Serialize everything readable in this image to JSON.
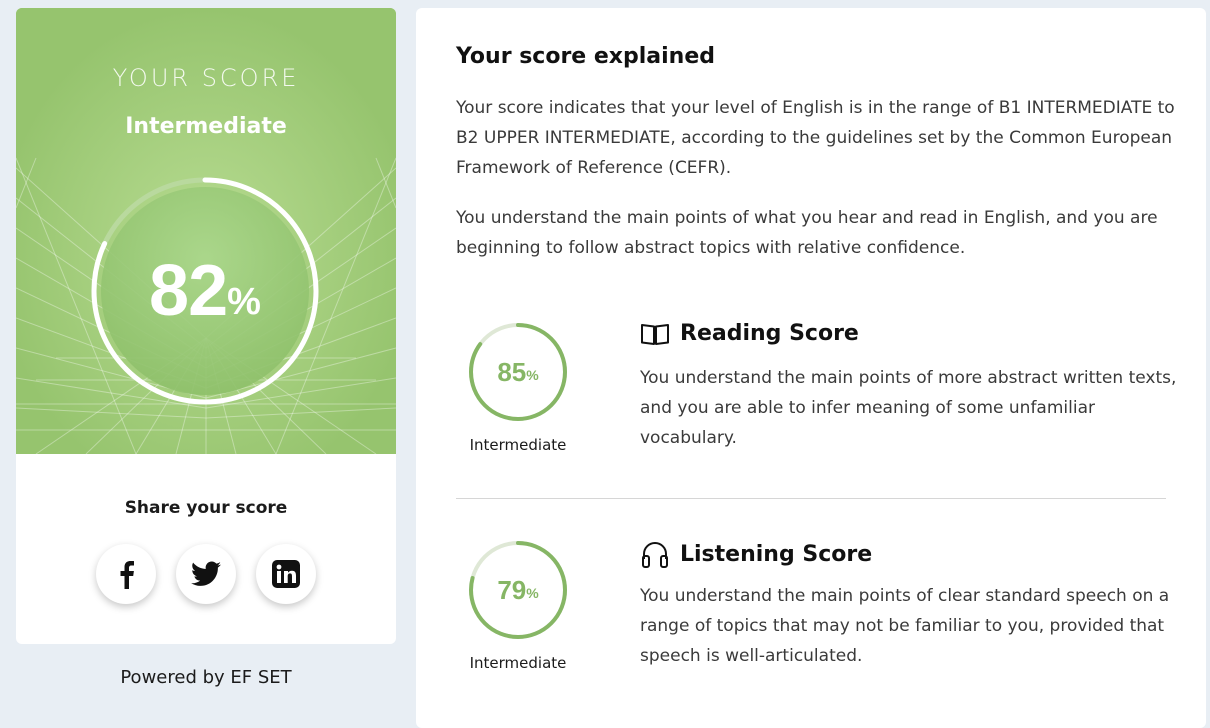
{
  "overall": {
    "label": "YOUR SCORE",
    "level": "Intermediate",
    "value": "82",
    "unit": "%",
    "progress": 0.82,
    "color": "#9cc875"
  },
  "share": {
    "title": "Share your score",
    "buttons": [
      {
        "icon": "facebook-icon"
      },
      {
        "icon": "twitter-icon"
      },
      {
        "icon": "linkedin-icon"
      }
    ]
  },
  "footer": {
    "powered": "Powered by EF SET"
  },
  "explain": {
    "title": "Your score explained",
    "paragraph1": "Your score indicates that your level of English is in the range of B1 INTERMEDIATE to B2 UPPER INTERMEDIATE, according to the guidelines set by the Common European Framework of Reference (CEFR).",
    "paragraph2": "You understand the main points of what you hear and read in English, and you are beginning to follow abstract topics with relative confidence."
  },
  "sections": [
    {
      "icon": "book-icon",
      "title": "Reading Score",
      "value": "85",
      "unit": "%",
      "progress": 0.85,
      "level": "Intermediate",
      "description": "You understand the main points of more abstract written texts, and you are able to infer meaning of some unfamiliar vocabulary."
    },
    {
      "icon": "headphones-icon",
      "title": "Listening Score",
      "value": "79",
      "unit": "%",
      "progress": 0.79,
      "level": "Intermediate",
      "description": "You understand the main points of clear standard speech on a range of topics that may not be familiar to you, provided that speech is well-articulated."
    }
  ],
  "colors": {
    "accent": "#86b665",
    "track": "#dfe8d6",
    "background": "#e8eef4"
  }
}
